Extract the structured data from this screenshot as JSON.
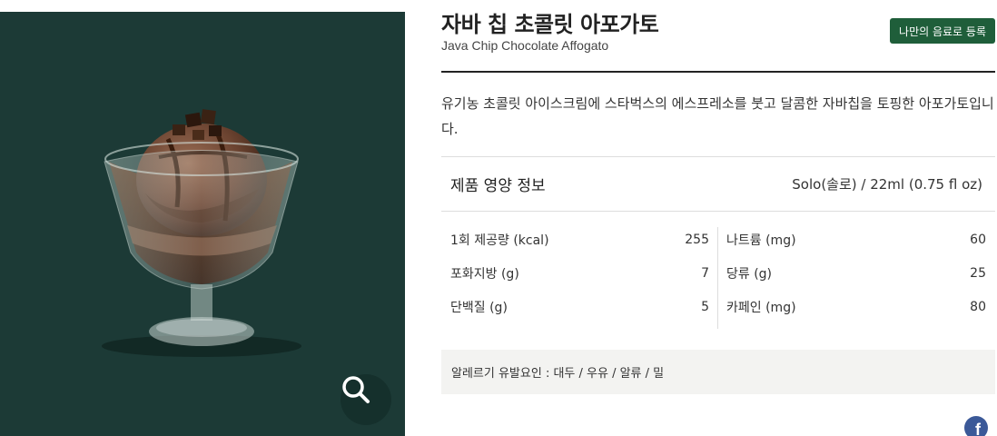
{
  "product": {
    "title_ko": "자바 칩 초콜릿 아포가토",
    "title_en": "Java Chip Chocolate Affogato",
    "register_button": "나만의 음료로 등록",
    "description": "유기농 초콜릿 아이스크림에 스타벅스의 에스프레소를 붓고 달콤한 자바칩을 토핑한 아포가토입니다."
  },
  "nutrition": {
    "header": "제품 영양 정보",
    "serving": "Solo(솔로) / 22ml (0.75 fl oz)",
    "left": [
      {
        "label": "1회 제공량 (kcal)",
        "value": "255"
      },
      {
        "label": "포화지방 (g)",
        "value": "7"
      },
      {
        "label": "단백질 (g)",
        "value": "5"
      }
    ],
    "right": [
      {
        "label": "나트륨 (mg)",
        "value": "60"
      },
      {
        "label": "당류 (g)",
        "value": "25"
      },
      {
        "label": "카페인 (mg)",
        "value": "80"
      }
    ]
  },
  "allergy": "알레르기 유발요인 : 대두 / 우유 / 알류 / 밀",
  "social": {
    "facebook": "f"
  },
  "icons": [
    "zoom-icon",
    "facebook-icon"
  ],
  "colors": {
    "image_bg": "#1c3a36",
    "brand_green": "#1f5e3a",
    "facebook": "#3b5998"
  }
}
